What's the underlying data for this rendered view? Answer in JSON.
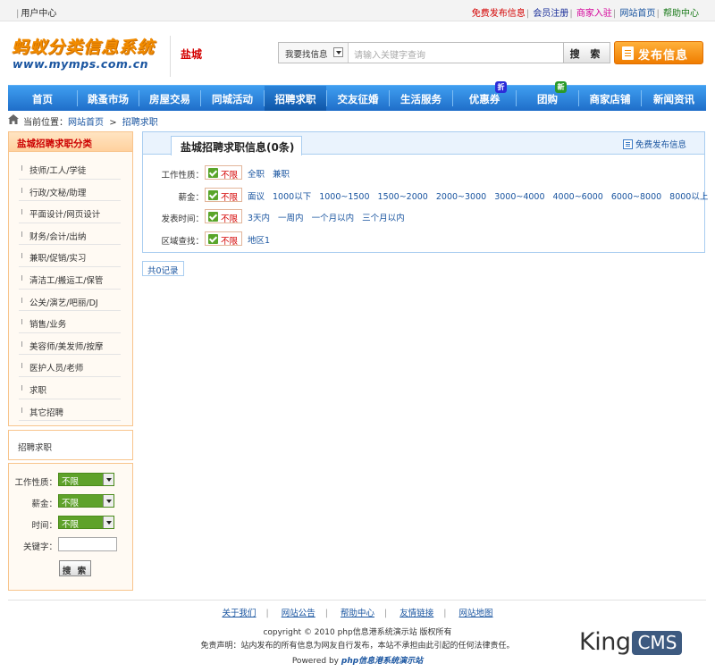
{
  "topbar": {
    "user_center": "用户中心",
    "links": [
      {
        "label": "免费发布信息",
        "color": "#d40000"
      },
      {
        "label": "会员注册",
        "color": "#1a2f9a"
      },
      {
        "label": "商家入驻",
        "color": "#d4009a"
      },
      {
        "label": "网站首页",
        "color": "#1a55a0"
      },
      {
        "label": "帮助中心",
        "color": "#1a7a1a"
      }
    ]
  },
  "header": {
    "logo_cn": "蚂蚁分类信息系统",
    "logo_en": "www.mymps.com.cn",
    "city": "盐城",
    "search": {
      "select_value": "我要找信息",
      "placeholder": "请输入关键字查询",
      "button": "搜 索"
    },
    "post_button": "发布信息"
  },
  "nav": {
    "items": [
      {
        "label": "首页"
      },
      {
        "label": "跳蚤市场"
      },
      {
        "label": "房屋交易"
      },
      {
        "label": "同城活动"
      },
      {
        "label": "招聘求职"
      },
      {
        "label": "交友征婚"
      },
      {
        "label": "生活服务"
      },
      {
        "label": "优惠券",
        "badge": "折"
      },
      {
        "label": "团购",
        "badge": "新"
      },
      {
        "label": "商家店铺"
      },
      {
        "label": "新闻资讯"
      }
    ],
    "active_index": 4,
    "colors": {
      "badge_discount": "#2b2bd9",
      "badge_new": "#2a9a2a"
    }
  },
  "breadcrumb": {
    "prefix": "当前位置：",
    "home": "网站首页",
    "sep": ">",
    "current": "招聘求职"
  },
  "sidebar": {
    "category_title": "盐城招聘求职分类",
    "categories": [
      "技师/工人/学徒",
      "行政/文秘/助理",
      "平面设计/网页设计",
      "财务/会计/出纳",
      "兼职/促销/实习",
      "清洁工/搬运工/保管",
      "公关/演艺/吧丽/DJ",
      "销售/业务",
      "美容师/美发师/按摩",
      "医护人员/老师",
      "求职",
      "其它招聘"
    ],
    "mid_label": "招聘求职",
    "form": {
      "work_type_label": "工作性质：",
      "work_type_value": "不限",
      "salary_label": "薪金：",
      "salary_value": "不限",
      "time_label": "时间：",
      "time_value": "不限",
      "keyword_label": "关键字：",
      "keyword_value": "",
      "search_button": "搜 索"
    }
  },
  "main": {
    "title": "盐城招聘求职信息(0条)",
    "free_post": "免费发布信息",
    "unlimited": "不限",
    "filters": [
      {
        "label": "工作性质：",
        "options": [
          "全职",
          "兼职"
        ]
      },
      {
        "label": "薪金：",
        "options": [
          "面议",
          "1000以下",
          "1000~1500",
          "1500~2000",
          "2000~3000",
          "3000~4000",
          "4000~6000",
          "6000~8000",
          "8000以上"
        ]
      },
      {
        "label": "发表时间：",
        "options": [
          "3天内",
          "一周内",
          "一个月以内",
          "三个月以内"
        ]
      },
      {
        "label": "区域查找：",
        "options": [
          "地区1"
        ]
      }
    ],
    "record_count": "共0记录"
  },
  "footer": {
    "links": [
      "关于我们",
      "网站公告",
      "帮助中心",
      "友情链接",
      "网站地图"
    ],
    "copyright": "copyright © 2010 php信息港系统演示站 版权所有",
    "disclaimer": "免责声明：站内发布的所有信息为网友自行发布，本站不承担由此引起的任何法律责任。",
    "powered_prefix": "Powered by",
    "powered_brand": "php信息港系统演示站",
    "logo_king": "King",
    "logo_cms": "CMS"
  }
}
